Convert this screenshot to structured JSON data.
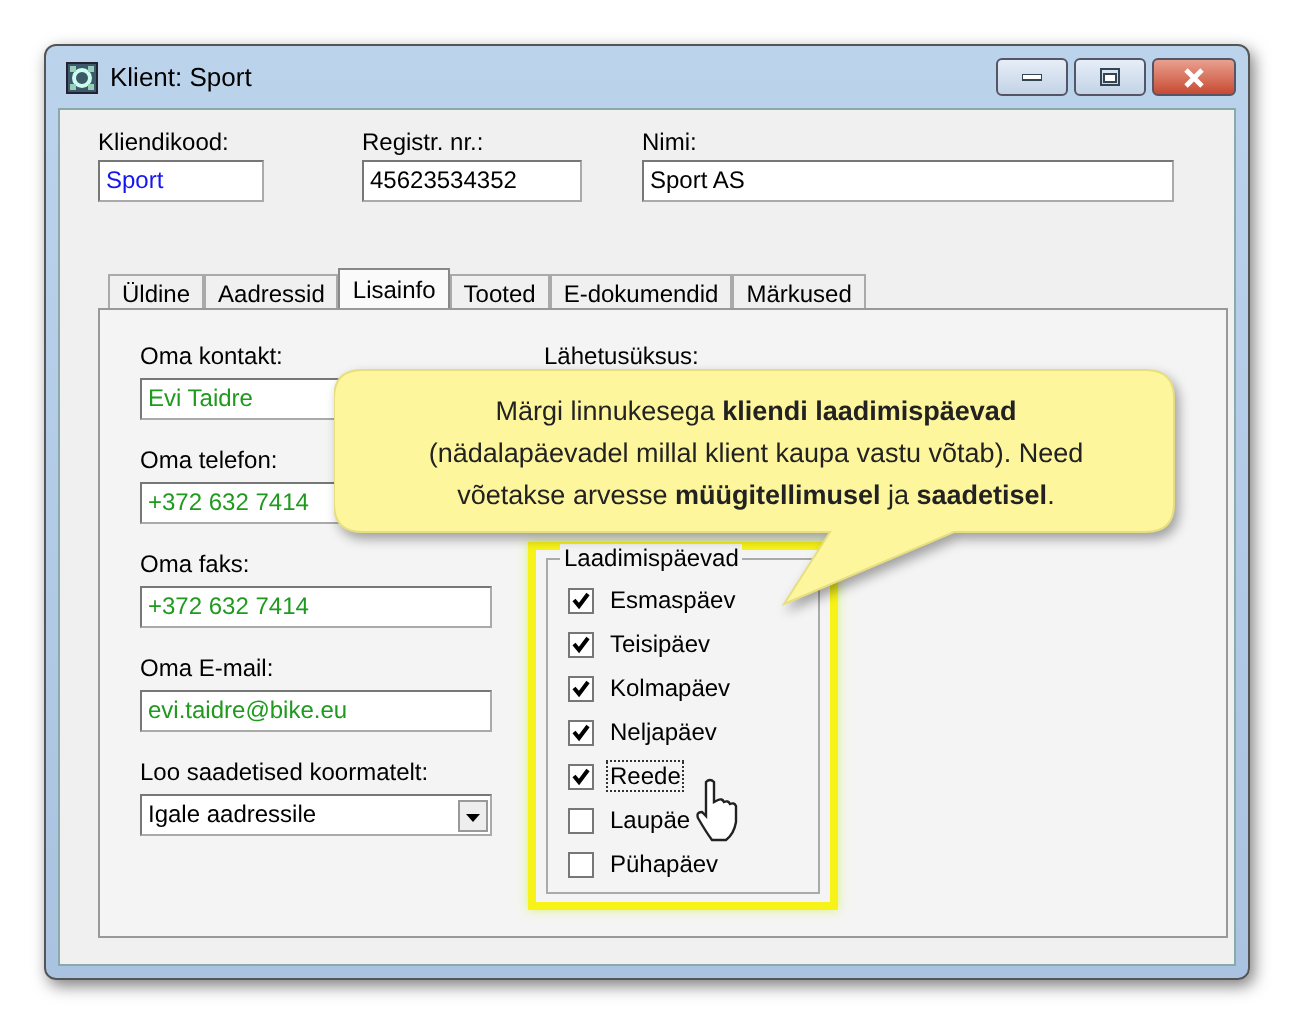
{
  "window": {
    "title": "Klient: Sport"
  },
  "header_fields": [
    {
      "label": "Kliendikood:",
      "value": "Sport",
      "kind": "code"
    },
    {
      "label": "Registr. nr.:",
      "value": "45623534352",
      "kind": "plain"
    },
    {
      "label": "Nimi:",
      "value": "Sport AS",
      "kind": "wide"
    }
  ],
  "tabs": [
    {
      "label": "Üldine",
      "selected": false
    },
    {
      "label": "Aadressid",
      "selected": false
    },
    {
      "label": "Lisainfo",
      "selected": true
    },
    {
      "label": "Tooted",
      "selected": false
    },
    {
      "label": "E-dokumendid",
      "selected": false
    },
    {
      "label": "Märkused",
      "selected": false
    }
  ],
  "contact_fields": [
    {
      "label": "Oma kontakt:",
      "value": "Evi Taidre",
      "kind": "text"
    },
    {
      "label": "Oma telefon:",
      "value": "+372 632 7414",
      "kind": "text"
    },
    {
      "label": "Oma faks:",
      "value": "+372 632 7414",
      "kind": "text"
    },
    {
      "label": "Oma E-mail:",
      "value": "evi.taidre@bike.eu",
      "kind": "text"
    },
    {
      "label": "Loo saadetised koormatelt:",
      "value": "Igale aadressile",
      "kind": "dropdown"
    }
  ],
  "shipping_unit_label": "Lähetusüksus:",
  "delivery_days": {
    "title": "Laadimispäevad",
    "days": [
      {
        "label": "Esmaspäev",
        "checked": true,
        "focused": false
      },
      {
        "label": "Teisipäev",
        "checked": true,
        "focused": false
      },
      {
        "label": "Kolmapäev",
        "checked": true,
        "focused": false
      },
      {
        "label": "Neljapäev",
        "checked": true,
        "focused": false
      },
      {
        "label": "Reede",
        "checked": true,
        "focused": true
      },
      {
        "label": "Laupäe",
        "checked": false,
        "focused": false
      },
      {
        "label": "Pühapäev",
        "checked": false,
        "focused": false
      }
    ]
  },
  "callout": {
    "lines": [
      "Märgi linnukesega **kliendi laadimispäevad**",
      "(nädalapäevadel millal klient kaupa vastu võtab). Need",
      "võetakse arvesse **müügitellimusel** ja **saadetisel**."
    ]
  }
}
